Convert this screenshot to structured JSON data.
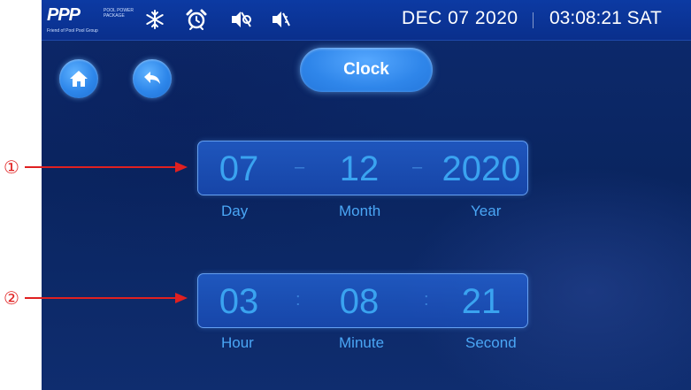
{
  "statusbar": {
    "logo_ppp": "PPP",
    "logo_sub": "POOL POWER PACKAGE",
    "logo_brand": "Friend of Pool Pool Group",
    "date": "DEC 07  2020",
    "time": "03:08:21  SAT",
    "icons": [
      "snowflake-icon",
      "alarm-clock-icon",
      "fan-muted-icon",
      "speaker-muted-icon"
    ]
  },
  "nav": {
    "home_icon": "home-icon",
    "back_icon": "back-icon",
    "title": "Clock"
  },
  "date_field": {
    "day": "07",
    "month": "12",
    "year": "2020",
    "separator": "–",
    "labels": {
      "day": "Day",
      "month": "Month",
      "year": "Year"
    }
  },
  "time_field": {
    "hour": "03",
    "minute": "08",
    "second": "21",
    "separator": ":",
    "labels": {
      "hour": "Hour",
      "minute": "Minute",
      "second": "Second"
    }
  },
  "annotations": {
    "one": "①",
    "two": "②",
    "color": "#e02020"
  }
}
